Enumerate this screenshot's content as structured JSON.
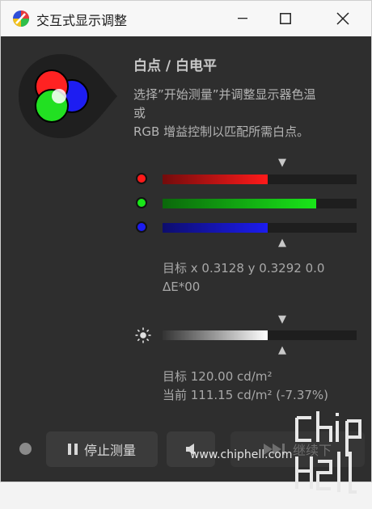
{
  "window": {
    "title": "交互式显示调整"
  },
  "panel": {
    "heading": "白点 / 白电平",
    "description_lines": [
      "选择”开始测量”并调整显示器色温",
      "或",
      "RGB 增益控制以匹配所需白点。"
    ]
  },
  "rgb": {
    "channels": [
      {
        "name": "red",
        "color": "#ff1a1a",
        "level": 0.54
      },
      {
        "name": "green",
        "color": "#19e619",
        "level": 0.79
      },
      {
        "name": "blue",
        "color": "#1c1cf0",
        "level": 0.54
      }
    ],
    "target_lines": [
      "目标 x 0.3128 y 0.3292 0.0",
      "ΔE*00"
    ]
  },
  "luminance": {
    "level": 0.54,
    "target_lines": [
      "目标 120.00 cd/m²",
      "当前 111.15 cd/m² (-7.37%)"
    ]
  },
  "buttons": {
    "stop_label": "停止测量",
    "continue_label": "继续下"
  },
  "watermark": "www.chiphell.com"
}
